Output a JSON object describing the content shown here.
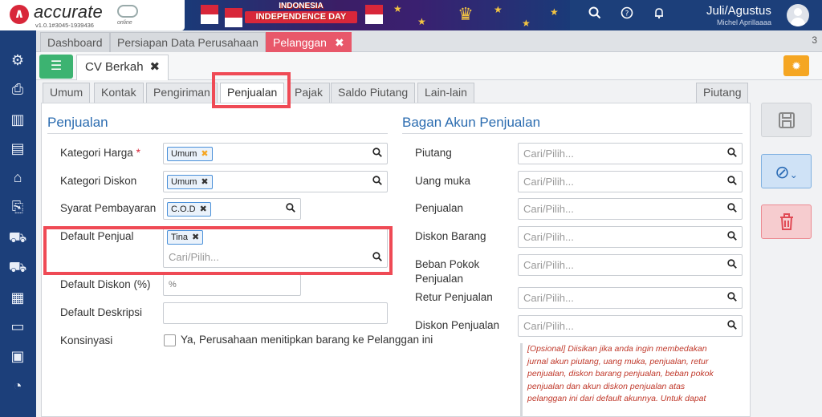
{
  "app": {
    "logo_text": "accurate",
    "logo_sub": "online",
    "version": "v1.0.1#3045-1939436",
    "banner_line1": "INDONESIA",
    "banner_line2": "INDEPENDENCE DAY",
    "period": "Juli/Agustus",
    "user": "Michel Aprillaaaa"
  },
  "top_icons": [
    "search-icon",
    "help-icon",
    "bell-icon"
  ],
  "doc_tabs": [
    {
      "label": "Dashboard"
    },
    {
      "label": "Persiapan Data Perusahaan"
    },
    {
      "label": "Pelanggan",
      "close": "✖"
    }
  ],
  "doc_tab_count": "3",
  "record_tab": {
    "label": "CV Berkah",
    "close": "✖"
  },
  "page_tabs": [
    "Umum",
    "Kontak",
    "Pengiriman",
    "Penjualan",
    "Pajak",
    "Saldo Piutang",
    "Lain-lain"
  ],
  "piutang_tab": "Piutang",
  "active_page_tab": "Penjualan",
  "penjualan": {
    "title": "Penjualan",
    "kategori_harga": {
      "label": "Kategori Harga",
      "required": "*",
      "value": "Umum"
    },
    "kategori_diskon": {
      "label": "Kategori Diskon",
      "value": "Umum"
    },
    "syarat_pembayaran": {
      "label": "Syarat Pembayaran",
      "value": "C.O.D"
    },
    "default_penjual": {
      "label": "Default Penjual",
      "value": "Tina",
      "placeholder": "Cari/Pilih..."
    },
    "default_diskon": {
      "label": "Default Diskon (%)",
      "unit": "%"
    },
    "default_deskripsi": {
      "label": "Default Deskripsi"
    },
    "konsinyasi": {
      "label": "Konsinyasi",
      "checkbox_label": "Ya, Perusahaan menitipkan barang ke Pelanggan ini",
      "checked": false
    }
  },
  "bagan_akun": {
    "title": "Bagan Akun Penjualan",
    "placeholder": "Cari/Pilih...",
    "fields": [
      {
        "label": "Piutang"
      },
      {
        "label": "Uang muka"
      },
      {
        "label": "Penjualan"
      },
      {
        "label": "Diskon Barang"
      },
      {
        "label": "Beban Pokok Penjualan"
      },
      {
        "label": "Retur Penjualan"
      },
      {
        "label": "Diskon Penjualan"
      }
    ],
    "note": "[Opsional] Diisikan jika anda ingin membedakan jurnal akun piutang, uang muka, penjualan, retur penjualan, diskon barang penjualan, beban pokok penjualan dan akun diskon penjualan atas pelanggan ini dari default akunnya. Untuk dapat"
  },
  "sidebar_icons": [
    "gear-icon",
    "printer-icon",
    "building-icon",
    "book-icon",
    "bank-icon",
    "receipt-icon",
    "cart-icon",
    "truck-cart-icon",
    "warehouse-icon",
    "conveyor-icon",
    "tax-icon",
    "report-icon"
  ],
  "colors": {
    "topbar": "#1c3f7a",
    "active_tab": "#e8586a",
    "accent_green": "#3cb371",
    "highlight": "#ef4a55",
    "section_title": "#2b6cb0"
  }
}
